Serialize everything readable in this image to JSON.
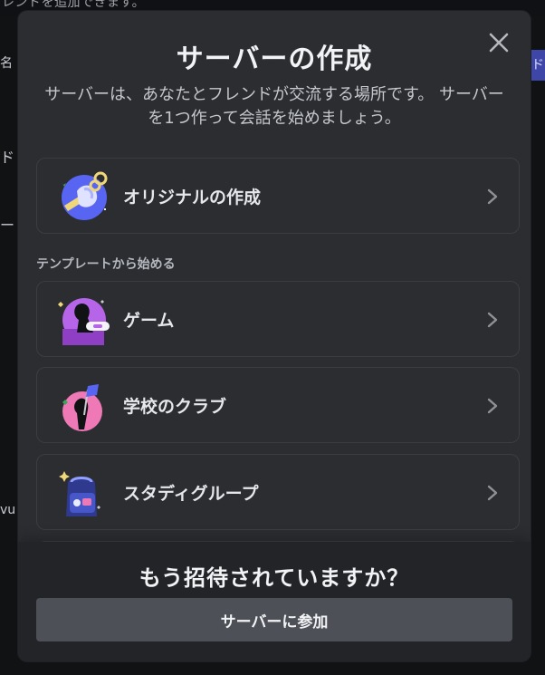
{
  "background": {
    "top_text": "レンドを追加できます。",
    "left_snippets": [
      "名",
      "ド",
      "ー",
      "vu"
    ],
    "right_snippet": "ド"
  },
  "modal": {
    "title": "サーバーの作成",
    "description": "サーバーは、あなたとフレンドが交流する場所です。 サーバーを1つ作って会話を始めましょう。",
    "close_icon": "close-icon",
    "create_own": {
      "label": "オリジナルの作成",
      "icon": "create-original-illustration-icon"
    },
    "template_section_label": "テンプレートから始める",
    "templates": [
      {
        "label": "ゲーム",
        "icon": "gaming-illustration-icon"
      },
      {
        "label": "学校のクラブ",
        "icon": "school-club-illustration-icon"
      },
      {
        "label": "スタディグループ",
        "icon": "study-group-illustration-icon"
      }
    ],
    "footer": {
      "question": "もう招待されていますか？",
      "join_button": "サーバーに参加"
    }
  },
  "colors": {
    "modal_bg": "#2b2d31",
    "footer_bg": "#232428",
    "card_border": "#3b3d43",
    "join_button_bg": "#4e5058",
    "text_primary": "#f2f3f5",
    "text_secondary": "#c4c7cc"
  }
}
